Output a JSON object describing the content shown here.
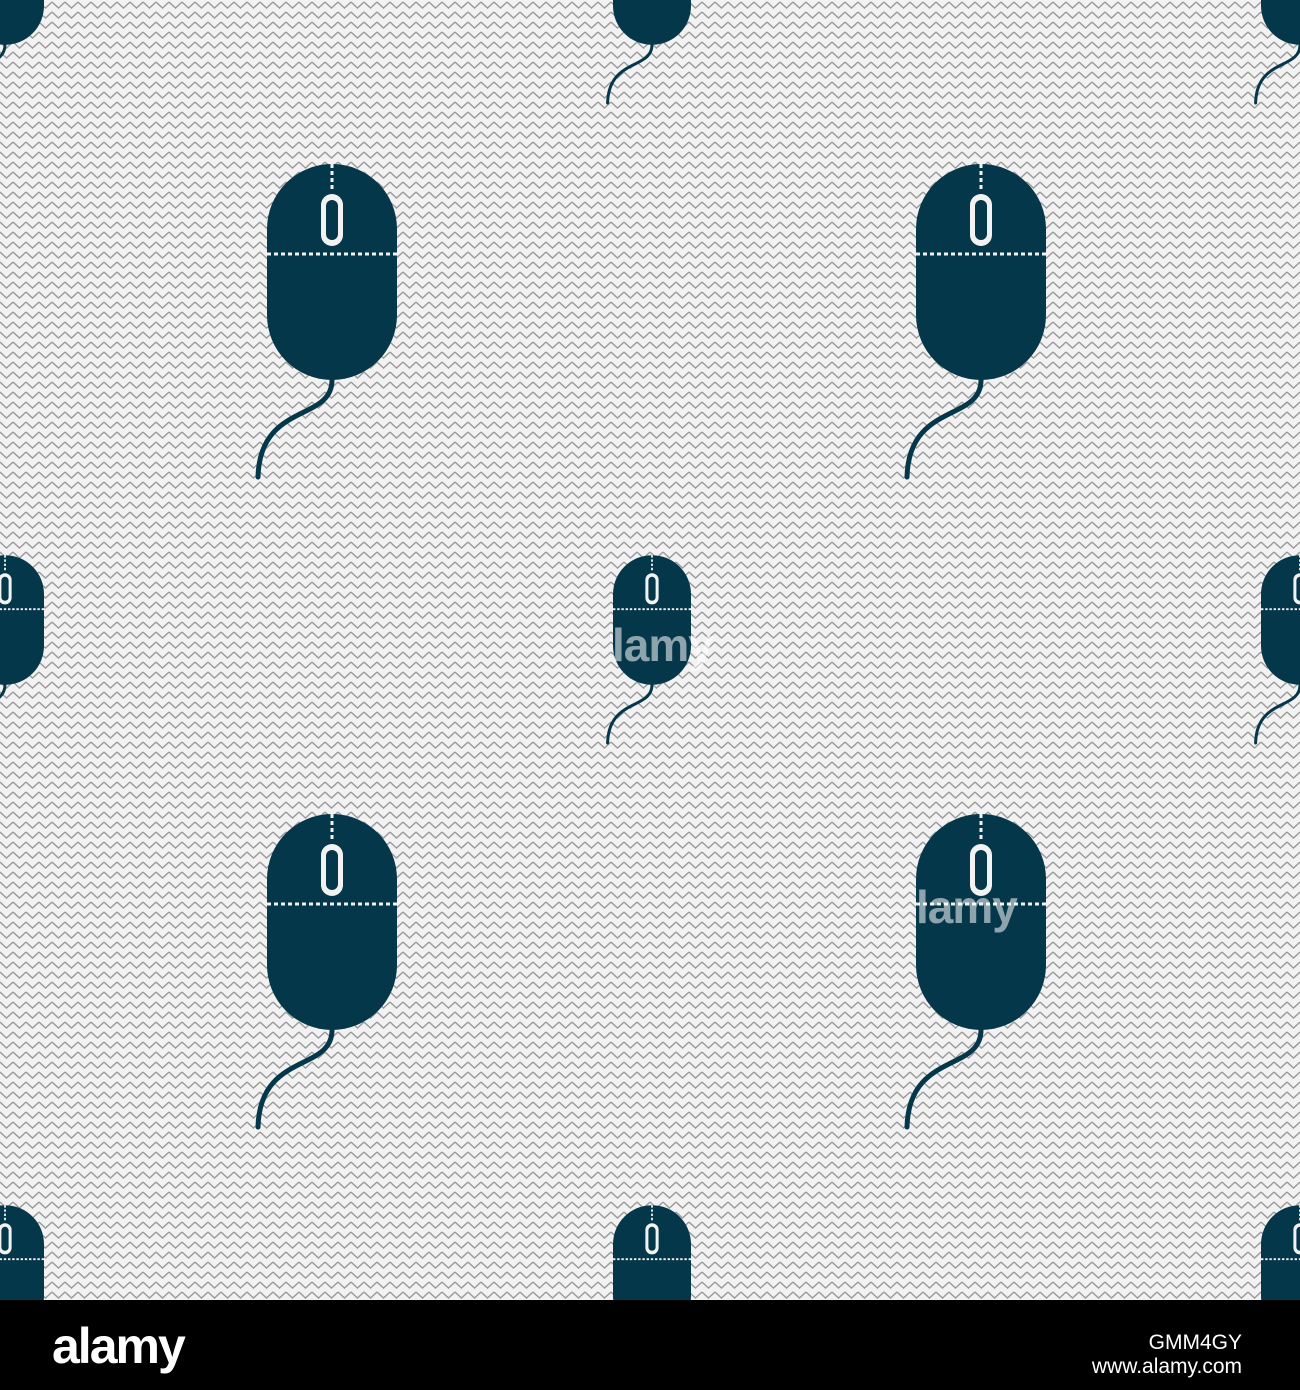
{
  "watermark": {
    "center": "lamy",
    "lower_right": "lamy"
  },
  "footer": {
    "logo_text": "alamy",
    "image_id": "GMM4GY",
    "url": "www.alamy.com"
  },
  "colors": {
    "icon": "#05374a",
    "background": "#f2f2f2",
    "stripe": "#9a9a9a",
    "footer_bg": "#000000",
    "footer_text": "#ffffff"
  },
  "icon_name": "computer-mouse-icon"
}
